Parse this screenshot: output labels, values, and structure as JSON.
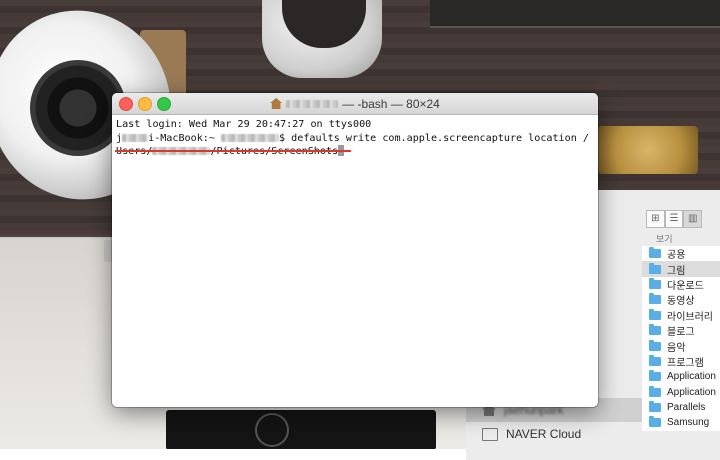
{
  "terminal": {
    "title_suffix": " — -bash — 80×24",
    "line1": "Last login: Wed Mar 29 20:47:27 on ttys000",
    "prompt_host": "i-MacBook:~ ",
    "prompt_cmd": "$ defaults write com.apple.screencapture location /",
    "line3_prefix": "Users/",
    "line3_path": "/Pictures/ScreenShots"
  },
  "finder": {
    "view_label": "보기",
    "folders": [
      "공용",
      "그림",
      "다운로드",
      "동영상",
      "라이브러리",
      "블로그",
      "음악",
      "프로그램",
      "Application",
      "Application",
      "Parallels",
      "Samsung"
    ],
    "selected_folder_index": 1,
    "sidebar_items": [
      "jaehunpark",
      "NAVER Cloud"
    ],
    "selected_sidebar_index": 0
  },
  "colors": {
    "accent_underline": "#d83a2e",
    "folder": "#5aaee6",
    "traffic_close": "#fc605c",
    "traffic_min": "#fdbc40",
    "traffic_max": "#34c84a"
  }
}
